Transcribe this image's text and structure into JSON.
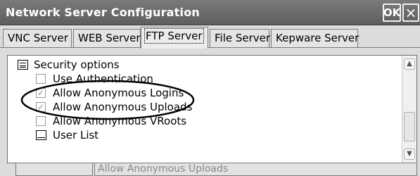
{
  "window": {
    "title": "Network Server Configuration",
    "ok_label": "OK",
    "close_glyph": "×"
  },
  "tabs": [
    {
      "label": "VNC Server",
      "active": false
    },
    {
      "label": "WEB Server",
      "active": false
    },
    {
      "label": "FTP Server",
      "active": true
    },
    {
      "label": "File Server",
      "active": false
    },
    {
      "label": "Kepware Server",
      "active": false
    }
  ],
  "tree": {
    "group_label": "Security options",
    "items": [
      {
        "label": "Use Authentication",
        "checked": false
      },
      {
        "label": "Allow Anonymous Logins",
        "checked": true
      },
      {
        "label": "Allow Anonymous Uploads",
        "checked": true
      },
      {
        "label": "Allow Anonymous VRoots",
        "checked": false
      }
    ],
    "list_item": {
      "label": "User List"
    }
  },
  "status": {
    "left_value": "",
    "selected_item": "Allow Anonymous Uploads"
  },
  "icons": {
    "folder": "security-options-icon",
    "list": "user-list-icon",
    "check": "✓",
    "scroll_up": "▲",
    "scroll_down": "▼"
  },
  "colors": {
    "titlebar": "#6b6b6b",
    "annotation": "#000000",
    "disabled_text": "#8a8a8a"
  }
}
